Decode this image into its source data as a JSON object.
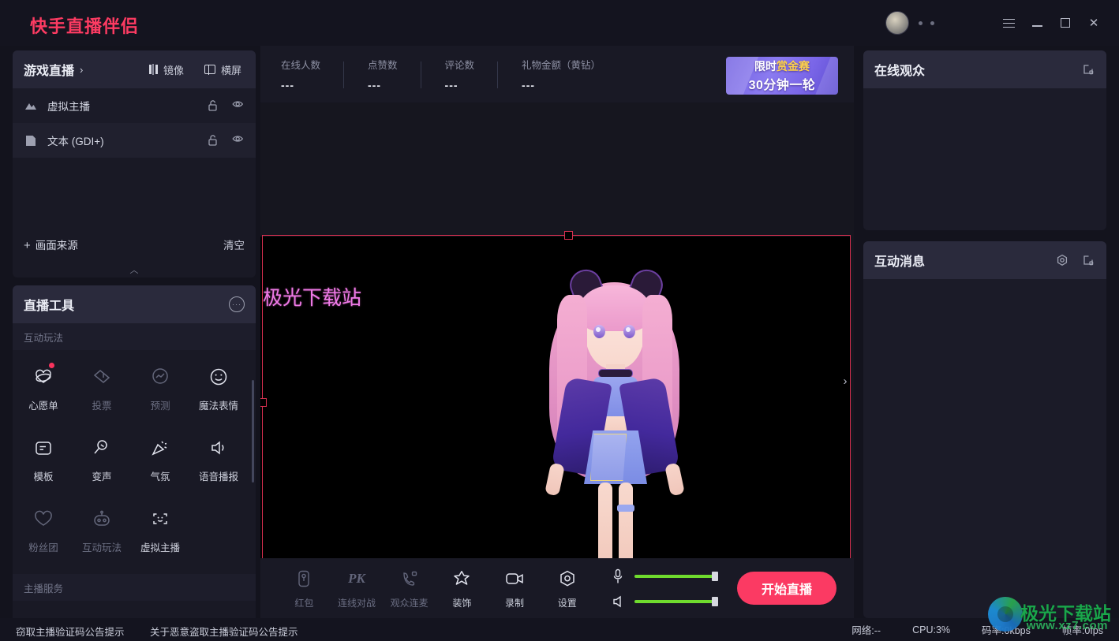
{
  "app": {
    "brand": "快手直播伴侣"
  },
  "titlebar": {
    "menu_icon": "hamburger-icon",
    "minimize_icon": "minimize-icon",
    "maximize_icon": "maximize-icon",
    "close_label": "✕"
  },
  "sources": {
    "title": "游戏直播",
    "chevron": "›",
    "mirror_label": "镜像",
    "landscape_label": "横屏",
    "items": [
      {
        "name": "虚拟主播",
        "icon": "image-icon",
        "lock": "unlock-icon",
        "visibility": "eye-icon"
      },
      {
        "name": "文本 (GDI+)",
        "icon": "text-icon",
        "lock": "unlock-icon",
        "visibility": "eye-icon"
      }
    ],
    "add_label": "画面来源",
    "add_plus": "+",
    "clear_label": "清空",
    "collapse_icon": "chevron-up-icon"
  },
  "tools": {
    "title": "直播工具",
    "more_label": "···",
    "section_interactive": "互动玩法",
    "section_service": "主播服务",
    "items": [
      {
        "label": "心愿单",
        "icon": "wish-heart-icon",
        "dim": false,
        "badge": true
      },
      {
        "label": "投票",
        "icon": "vote-ticket-icon",
        "dim": true,
        "badge": false
      },
      {
        "label": "预测",
        "icon": "predict-chart-icon",
        "dim": true,
        "badge": false
      },
      {
        "label": "魔法表情",
        "icon": "magic-emoji-icon",
        "dim": false,
        "badge": false
      },
      {
        "label": "模板",
        "icon": "template-icon",
        "dim": false,
        "badge": false
      },
      {
        "label": "变声",
        "icon": "voice-change-icon",
        "dim": false,
        "badge": false
      },
      {
        "label": "气氛",
        "icon": "party-popper-icon",
        "dim": false,
        "badge": false
      },
      {
        "label": "语音播报",
        "icon": "speaker-icon",
        "dim": false,
        "badge": false
      },
      {
        "label": "粉丝团",
        "icon": "heart-outline-icon",
        "dim": true,
        "badge": false
      },
      {
        "label": "互动玩法",
        "icon": "robot-icon",
        "dim": true,
        "badge": false
      },
      {
        "label": "虚拟主播",
        "icon": "face-scan-icon",
        "dim": false,
        "badge": false
      }
    ]
  },
  "stats": [
    {
      "key": "在线人数",
      "value": "---"
    },
    {
      "key": "点赞数",
      "value": "---"
    },
    {
      "key": "评论数",
      "value": "---"
    },
    {
      "key": "礼物金额（黄钻）",
      "value": "---"
    }
  ],
  "promo": {
    "line1_prefix": "限时",
    "line1_highlight": "赏金赛",
    "line2": "30分钟一轮",
    "highlight_color": "#ffd24a"
  },
  "preview": {
    "overlay_text": "极光下载站",
    "overlay_color": "#ef7ae8",
    "selection_color": "#d83050",
    "collapse_icon": "chevron-right-icon"
  },
  "controls": {
    "buttons": [
      {
        "label": "红包",
        "icon": "red-packet-icon",
        "dim": true
      },
      {
        "label": "连线对战",
        "icon": "pk-icon",
        "dim": true
      },
      {
        "label": "观众连麦",
        "icon": "audience-mic-icon",
        "dim": true
      },
      {
        "label": "装饰",
        "icon": "decoration-icon",
        "dim": false
      },
      {
        "label": "录制",
        "icon": "record-camera-icon",
        "dim": false
      },
      {
        "label": "设置",
        "icon": "settings-gear-icon",
        "dim": false
      }
    ],
    "mic_icon": "microphone-icon",
    "speaker_icon": "speaker-volume-icon",
    "mic_level": 100,
    "speaker_level": 100,
    "slider_color": "#6fdb2e",
    "go_live_label": "开始直播",
    "go_live_color": "#fb3a63"
  },
  "right_panels": [
    {
      "title": "在线观众",
      "popout_icon": "popout-icon",
      "has_settings": false
    },
    {
      "title": "互动消息",
      "popout_icon": "popout-icon",
      "settings_icon": "gear-icon",
      "has_settings": true
    }
  ],
  "status": {
    "notice_1": "窃取主播验证码公告提示",
    "notice_2": "关于恶意盗取主播验证码公告提示",
    "network": "网络:--",
    "cpu": "CPU:3%",
    "bitrate": "码率:0kbps",
    "fps": "帧率:0fps"
  },
  "watermark": {
    "text": "极光下载站",
    "url": "www.xz7.com"
  }
}
